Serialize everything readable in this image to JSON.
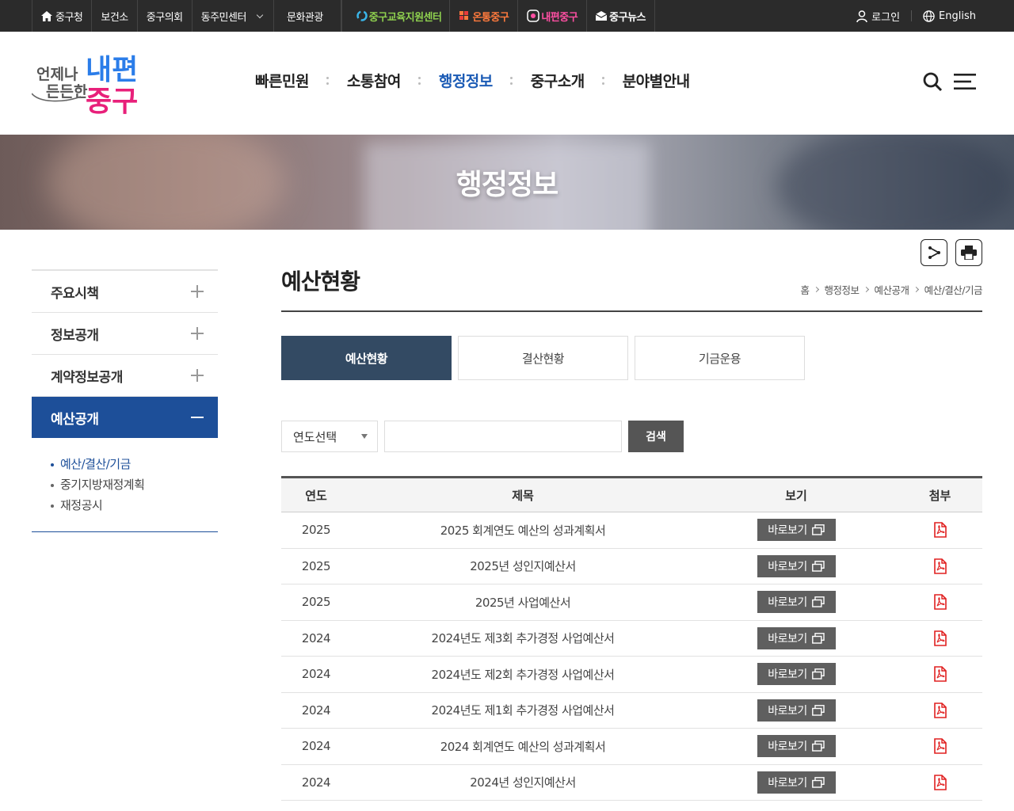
{
  "topbar": {
    "links": [
      {
        "label": "중구청",
        "icon": "home-icon"
      },
      {
        "label": "보건소"
      },
      {
        "label": "중구의회"
      },
      {
        "label": "동주민센터",
        "dropdown": true
      }
    ],
    "culture": "문화관광",
    "brands": [
      "중구교육지원센터",
      "온통중구",
      "내편중구",
      "중구뉴스"
    ],
    "login": "로그인",
    "english": "English"
  },
  "header": {
    "logo": {
      "small1": "언제나",
      "small2": "든든한",
      "big1": "내편",
      "big2": "중구"
    },
    "menu": [
      "빠른민원",
      "소통참여",
      "행정정보",
      "중구소개",
      "분야별안내"
    ],
    "active_menu_index": 2
  },
  "visual": {
    "title": "행정정보"
  },
  "lnb": {
    "items": [
      "주요시책",
      "정보공개",
      "계약정보공개",
      "예산공개"
    ],
    "active_index": 3,
    "sub": [
      "예산/결산/기금",
      "중기지방재정계획",
      "재정공시"
    ],
    "active_sub_index": 0
  },
  "content": {
    "title": "예산현황",
    "breadcrumb": [
      "홈",
      "행정정보",
      "예산공개",
      "예산/결산/기금"
    ],
    "tabs": [
      "예산현황",
      "결산현황",
      "기금운용"
    ],
    "active_tab_index": 0,
    "search": {
      "select_value": "연도선택",
      "input_value": "",
      "button": "검색"
    },
    "table": {
      "headers": [
        "연도",
        "제목",
        "보기",
        "첨부"
      ],
      "view_label": "바로보기",
      "rows": [
        {
          "year": "2025",
          "title": "2025 회계연도 예산의 성과계획서"
        },
        {
          "year": "2025",
          "title": "2025년 성인지예산서"
        },
        {
          "year": "2025",
          "title": "2025년 사업예산서"
        },
        {
          "year": "2024",
          "title": "2024년도 제3회 추가경정 사업예산서"
        },
        {
          "year": "2024",
          "title": "2024년도 제2회 추가경정 사업예산서"
        },
        {
          "year": "2024",
          "title": "2024년도 제1회 추가경정 사업예산서"
        },
        {
          "year": "2024",
          "title": "2024 회계연도 예산의 성과계획서"
        },
        {
          "year": "2024",
          "title": "2024년 성인지예산서"
        }
      ]
    }
  },
  "colors": {
    "accent": "#1b5bb5",
    "lnb_active": "#1d4f99",
    "tab_active": "#334a63",
    "pdf": "#e02020",
    "logo_blue": "#2b7de9",
    "logo_pink": "#e8207a"
  }
}
